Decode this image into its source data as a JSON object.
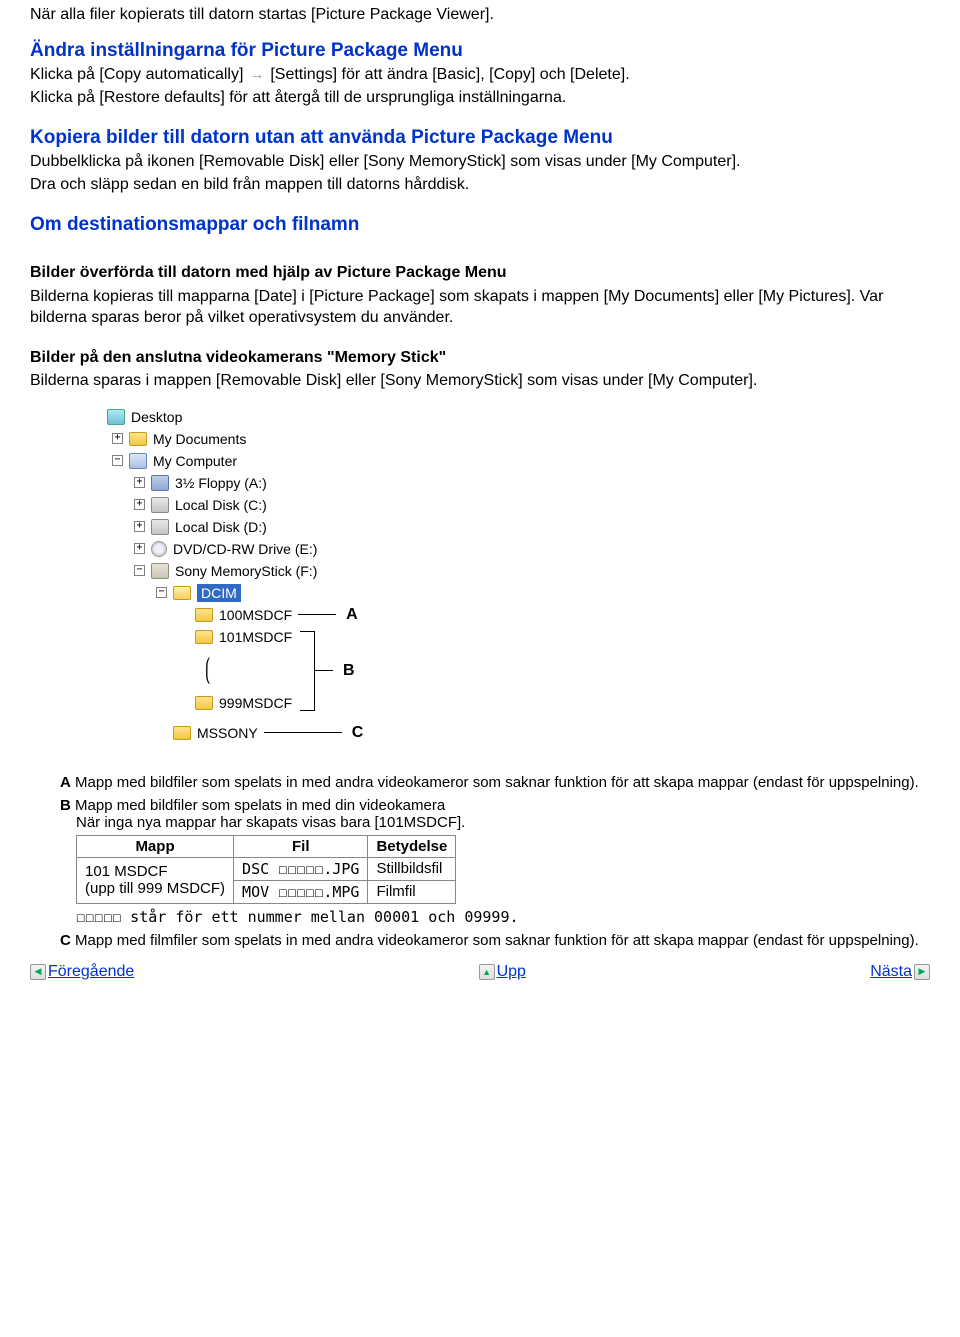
{
  "intro": "När alla filer kopierats till datorn startas [Picture Package Viewer].",
  "section1": {
    "heading": "Ändra inställningarna för Picture Package Menu",
    "line1a": "Klicka på [Copy automatically]",
    "line1b": "[Settings] för att ändra [Basic], [Copy] och [Delete].",
    "line2": "Klicka på [Restore defaults] för att återgå till de ursprungliga inställningarna."
  },
  "section2": {
    "heading": "Kopiera bilder till datorn utan att använda Picture Package Menu",
    "line1": "Dubbelklicka på ikonen [Removable Disk] eller [Sony MemoryStick] som visas under [My Computer].",
    "line2": "Dra och släpp sedan en bild från mappen till datorns hårddisk."
  },
  "section3": {
    "heading": "Om destinationsmappar och filnamn",
    "sub1_heading": "Bilder överförda till datorn med hjälp av Picture Package Menu",
    "sub1_body": "Bilderna kopieras till mapparna [Date] i [Picture Package] som skapats i mappen [My Documents] eller [My Pictures]. Var bilderna sparas beror på vilket operativsystem du använder.",
    "sub2_heading": "Bilder på den anslutna videokamerans \"Memory Stick\"",
    "sub2_body": "Bilderna sparas i mappen [Removable Disk] eller [Sony MemoryStick] som visas under [My Computer]."
  },
  "tree": {
    "desktop": "Desktop",
    "mydocs": "My Documents",
    "mycomp": "My Computer",
    "floppy": "3½ Floppy (A:)",
    "localc": "Local Disk (C:)",
    "locald": "Local Disk (D:)",
    "dvd": "DVD/CD-RW Drive (E:)",
    "sony": "Sony MemoryStick (F:)",
    "dcim": "DCIM",
    "f100": "100MSDCF",
    "f101": "101MSDCF",
    "f999": "999MSDCF",
    "mssony": "MSSONY",
    "A": "A",
    "B": "B",
    "C": "C"
  },
  "bullets": {
    "A": {
      "letter": "A",
      "text": "Mapp med bildfiler som spelats in med andra videokameror som saknar funktion för att skapa mappar (endast för uppspelning)."
    },
    "B": {
      "letter": "B",
      "line1": "Mapp med bildfiler som spelats in med din videokamera",
      "line2": "När inga nya mappar har skapats visas bara [101MSDCF]."
    },
    "table": {
      "h_mapp": "Mapp",
      "h_fil": "Fil",
      "h_bet": "Betydelse",
      "r1c1a": "101 MSDCF",
      "r1c1b": "(upp till 999 MSDCF)",
      "r1c2": "DSC ☐☐☐☐☐.JPG",
      "r1c3": "Stillbildsfil",
      "r2c2": "MOV ☐☐☐☐☐.MPG",
      "r2c3": "Filmfil"
    },
    "note": "☐☐☐☐☐ står för ett nummer mellan 00001 och 09999.",
    "C": {
      "letter": "C",
      "text": "Mapp med filmfiler som spelats in med andra videokameror som saknar funktion för att skapa mappar (endast för uppspelning)."
    }
  },
  "nav": {
    "prev": "Föregående",
    "up": "Upp",
    "next": "Nästa"
  }
}
